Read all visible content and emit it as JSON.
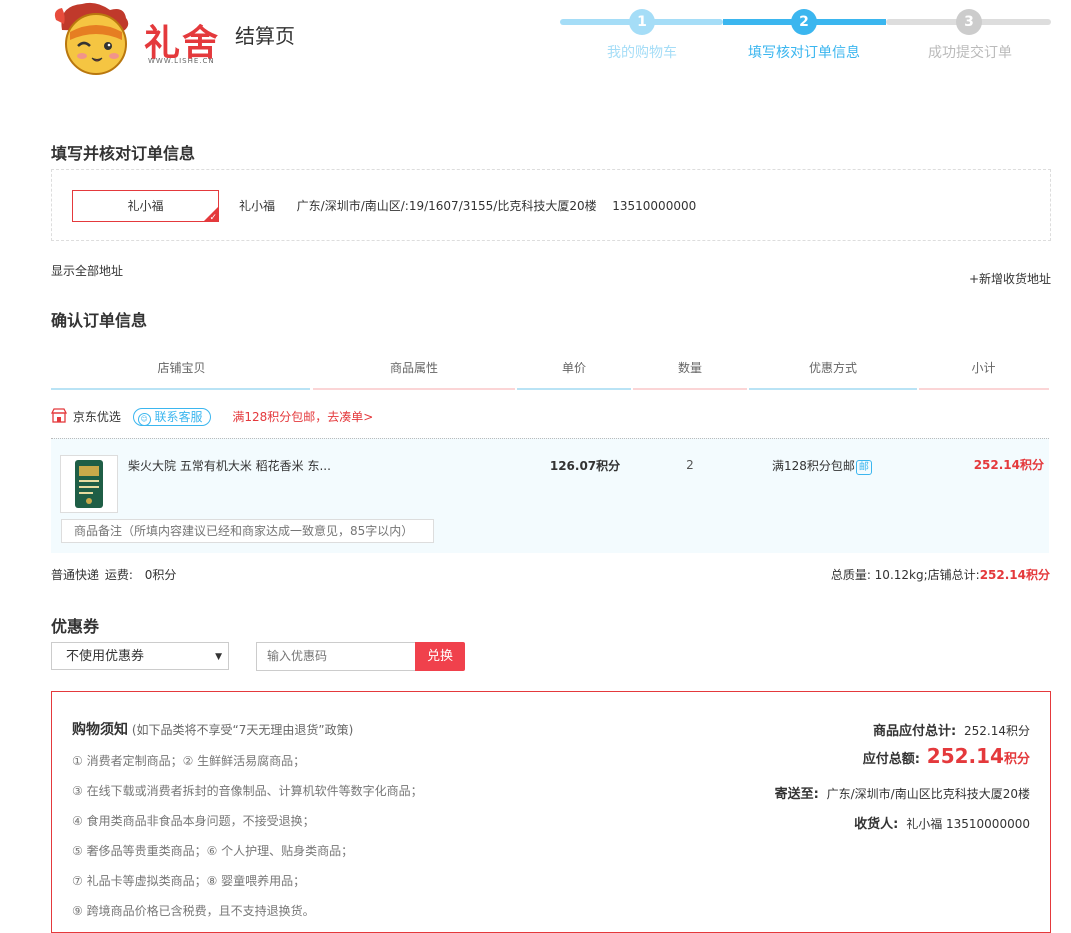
{
  "header": {
    "logo_text": "礼舍",
    "logo_url": "WWW.LISHE.CN",
    "page_label": "结算页",
    "steps": [
      {
        "num": "1",
        "label": "我的购物车"
      },
      {
        "num": "2",
        "label": "填写核对订单信息"
      },
      {
        "num": "3",
        "label": "成功提交订单"
      }
    ]
  },
  "address": {
    "section_title": "填写并核对订单信息",
    "selected_name": "礼小福",
    "receiver": "礼小福",
    "detail": "广东/深圳市/南山区/:19/1607/3155/比克科技大厦20楼",
    "phone": "13510000000",
    "show_all": "显示全部地址",
    "add_new": "+新增收货地址"
  },
  "order": {
    "section_title": "确认订单信息",
    "headers": [
      "店铺宝贝",
      "商品属性",
      "单价",
      "数量",
      "优惠方式",
      "小计"
    ],
    "shop": {
      "name": "京东优选",
      "service_btn": "联系客服",
      "promo": "满128积分包邮，去凑单>"
    },
    "item": {
      "title": "柴火大院 五常有机大米 稻花香米 东...",
      "price": "126.07积分",
      "qty": "2",
      "discount": "满128积分包邮",
      "discount_badge": "邮",
      "subtotal": "252.14积分",
      "remark_placeholder": "商品备注（所填内容建议已经和商家达成一致意见，85字以内）"
    },
    "shipping": "普通快递",
    "freight_label": "运费:",
    "freight": "0积分",
    "weight_text": "总质量: 10.12kg;店铺总计:",
    "shop_total": "252.14积分"
  },
  "coupon": {
    "section_title": "优惠券",
    "select_value": "不使用优惠券",
    "code_placeholder": "输入优惠码",
    "exchange_btn": "兑换"
  },
  "notice": {
    "title": "购物须知",
    "subtitle": "(如下品类将不享受“7天无理由退货”政策)",
    "items": [
      "① 消费者定制商品；② 生鲜鲜活易腐商品；",
      "③ 在线下载或消费者拆封的音像制品、计算机软件等数字化商品；",
      "④ 食用类商品非食品本身问题，不接受退换；",
      "⑤ 奢侈品等贵重类商品；⑥ 个人护理、贴身类商品；",
      "⑦ 礼品卡等虚拟类商品；⑧ 婴童喂养用品；",
      "⑨ 跨境商品价格已含税费，且不支持退换货。"
    ]
  },
  "summary": {
    "goods_total_label": "商品应付总计:",
    "goods_total": "252.14积分",
    "pay_total_label": "应付总额:",
    "pay_total": "252.14",
    "pay_unit": "积分",
    "ship_to_label": "寄送至:",
    "ship_to": "广东/深圳市/南山区比克科技大厦20楼",
    "receiver_label": "收货人:",
    "receiver": "礼小福 13510000000"
  },
  "colors": {
    "brand_red": "#e4393c",
    "step_done": "#a5ddf7",
    "step_active": "#3bb6ef",
    "step_todo": "#ddd"
  }
}
